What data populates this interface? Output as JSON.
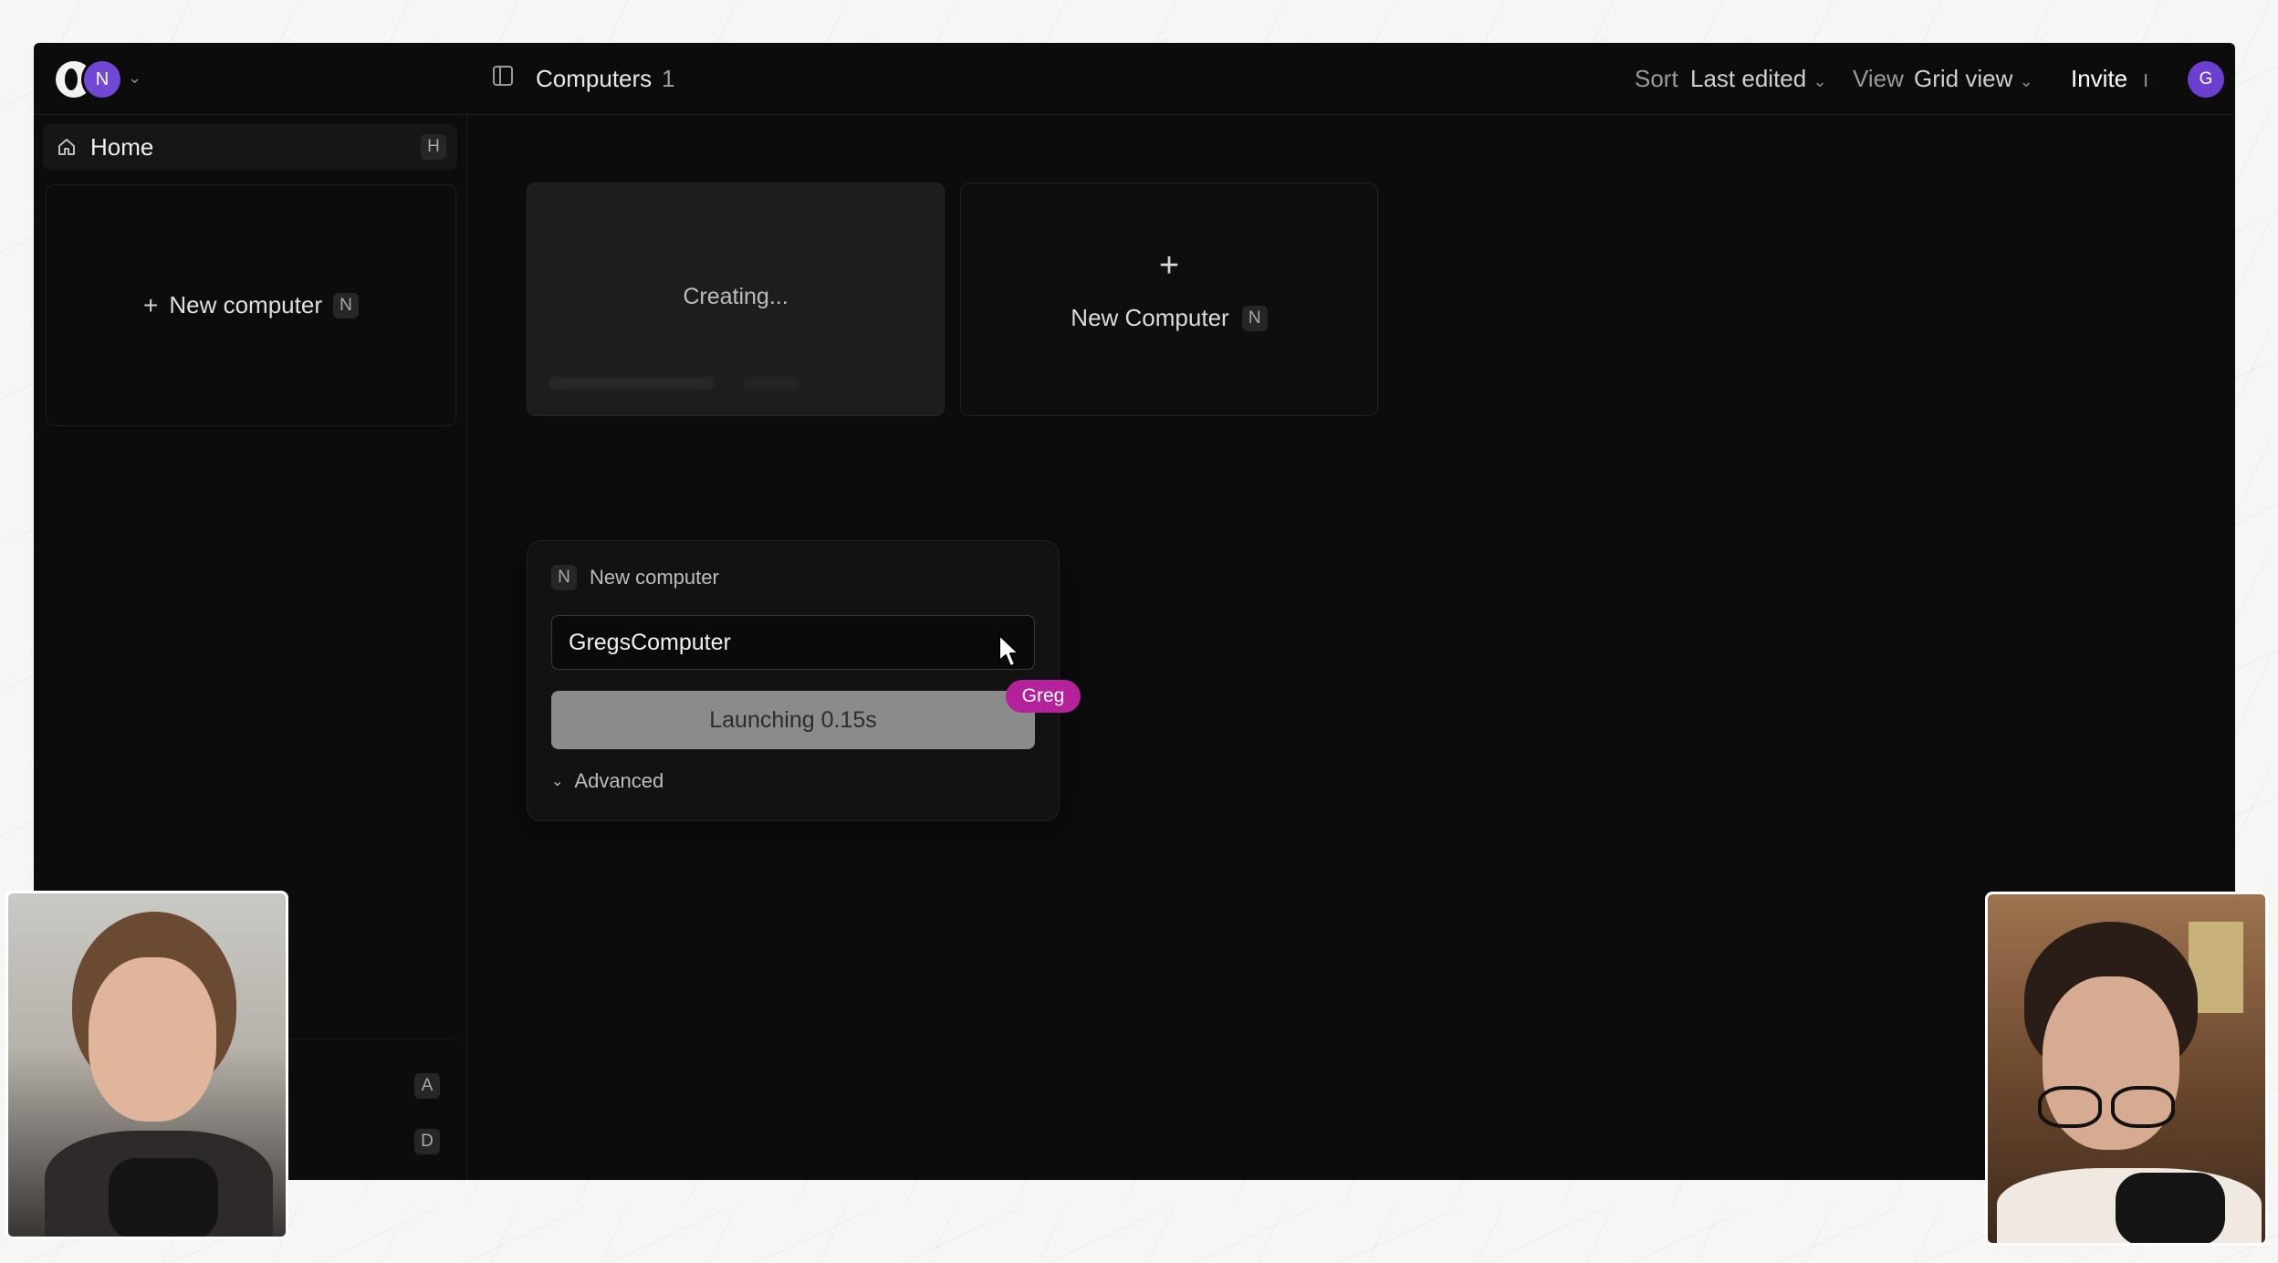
{
  "topbar": {
    "org_initial": "N",
    "breadcrumb_title": "Computers",
    "count": "1",
    "sort_label": "Sort",
    "sort_value": "Last edited",
    "view_label": "View",
    "view_value": "Grid view",
    "invite_label": "Invite",
    "invite_shortcut": "I",
    "user_initial": "G"
  },
  "sidebar": {
    "home_label": "Home",
    "home_shortcut": "H",
    "new_computer_label": "New computer",
    "new_computer_shortcut": "N",
    "bottom_shortcut_1": "A",
    "bottom_shortcut_2": "D"
  },
  "main": {
    "creating_card_text": "Creating...",
    "new_card_label": "New Computer",
    "new_card_shortcut": "N"
  },
  "dialog": {
    "shortcut": "N",
    "title": "New computer",
    "name_value": "GregsComputer",
    "launch_label": "Launching 0.15s",
    "advanced_label": "Advanced"
  },
  "cursor_tag": "Greg",
  "colors": {
    "app_bg": "#0c0c0c",
    "accent_purple": "#7148d6",
    "tag_magenta": "#b4219b"
  }
}
